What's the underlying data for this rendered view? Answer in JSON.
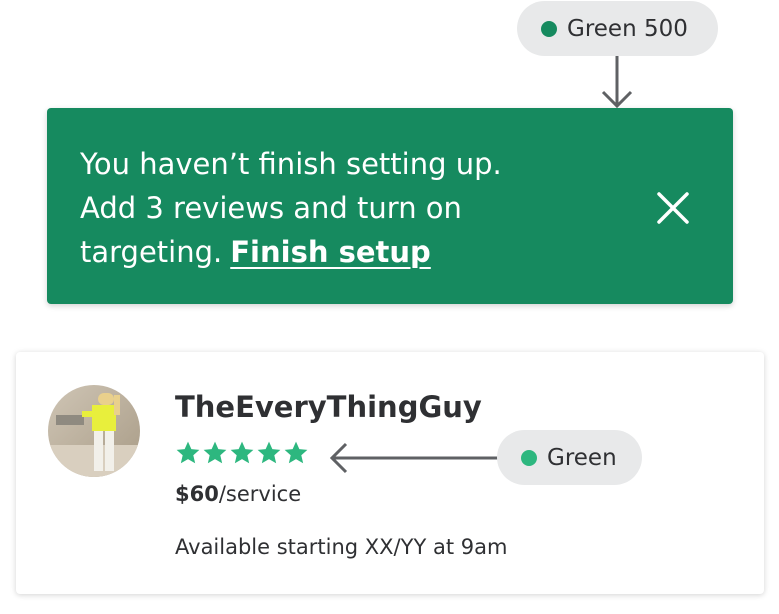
{
  "annotations": {
    "banner_color_label": "Green 500",
    "banner_color": "#168a5f",
    "stars_color_label": "Green",
    "stars_color": "#2db77f"
  },
  "banner": {
    "line1": "You haven’t finish setting up.",
    "line2": "Add 3 reviews and turn on",
    "line3": "targeting.",
    "link_label": "Finish setup",
    "close_icon": "close-icon"
  },
  "pro_card": {
    "name": "TheEveryThingGuy",
    "rating": 5,
    "rating_max": 5,
    "price_amount": "$60",
    "price_unit": "/service",
    "availability": "Available starting XX/YY at 9am",
    "avatar_icon": "avatar-photo"
  }
}
